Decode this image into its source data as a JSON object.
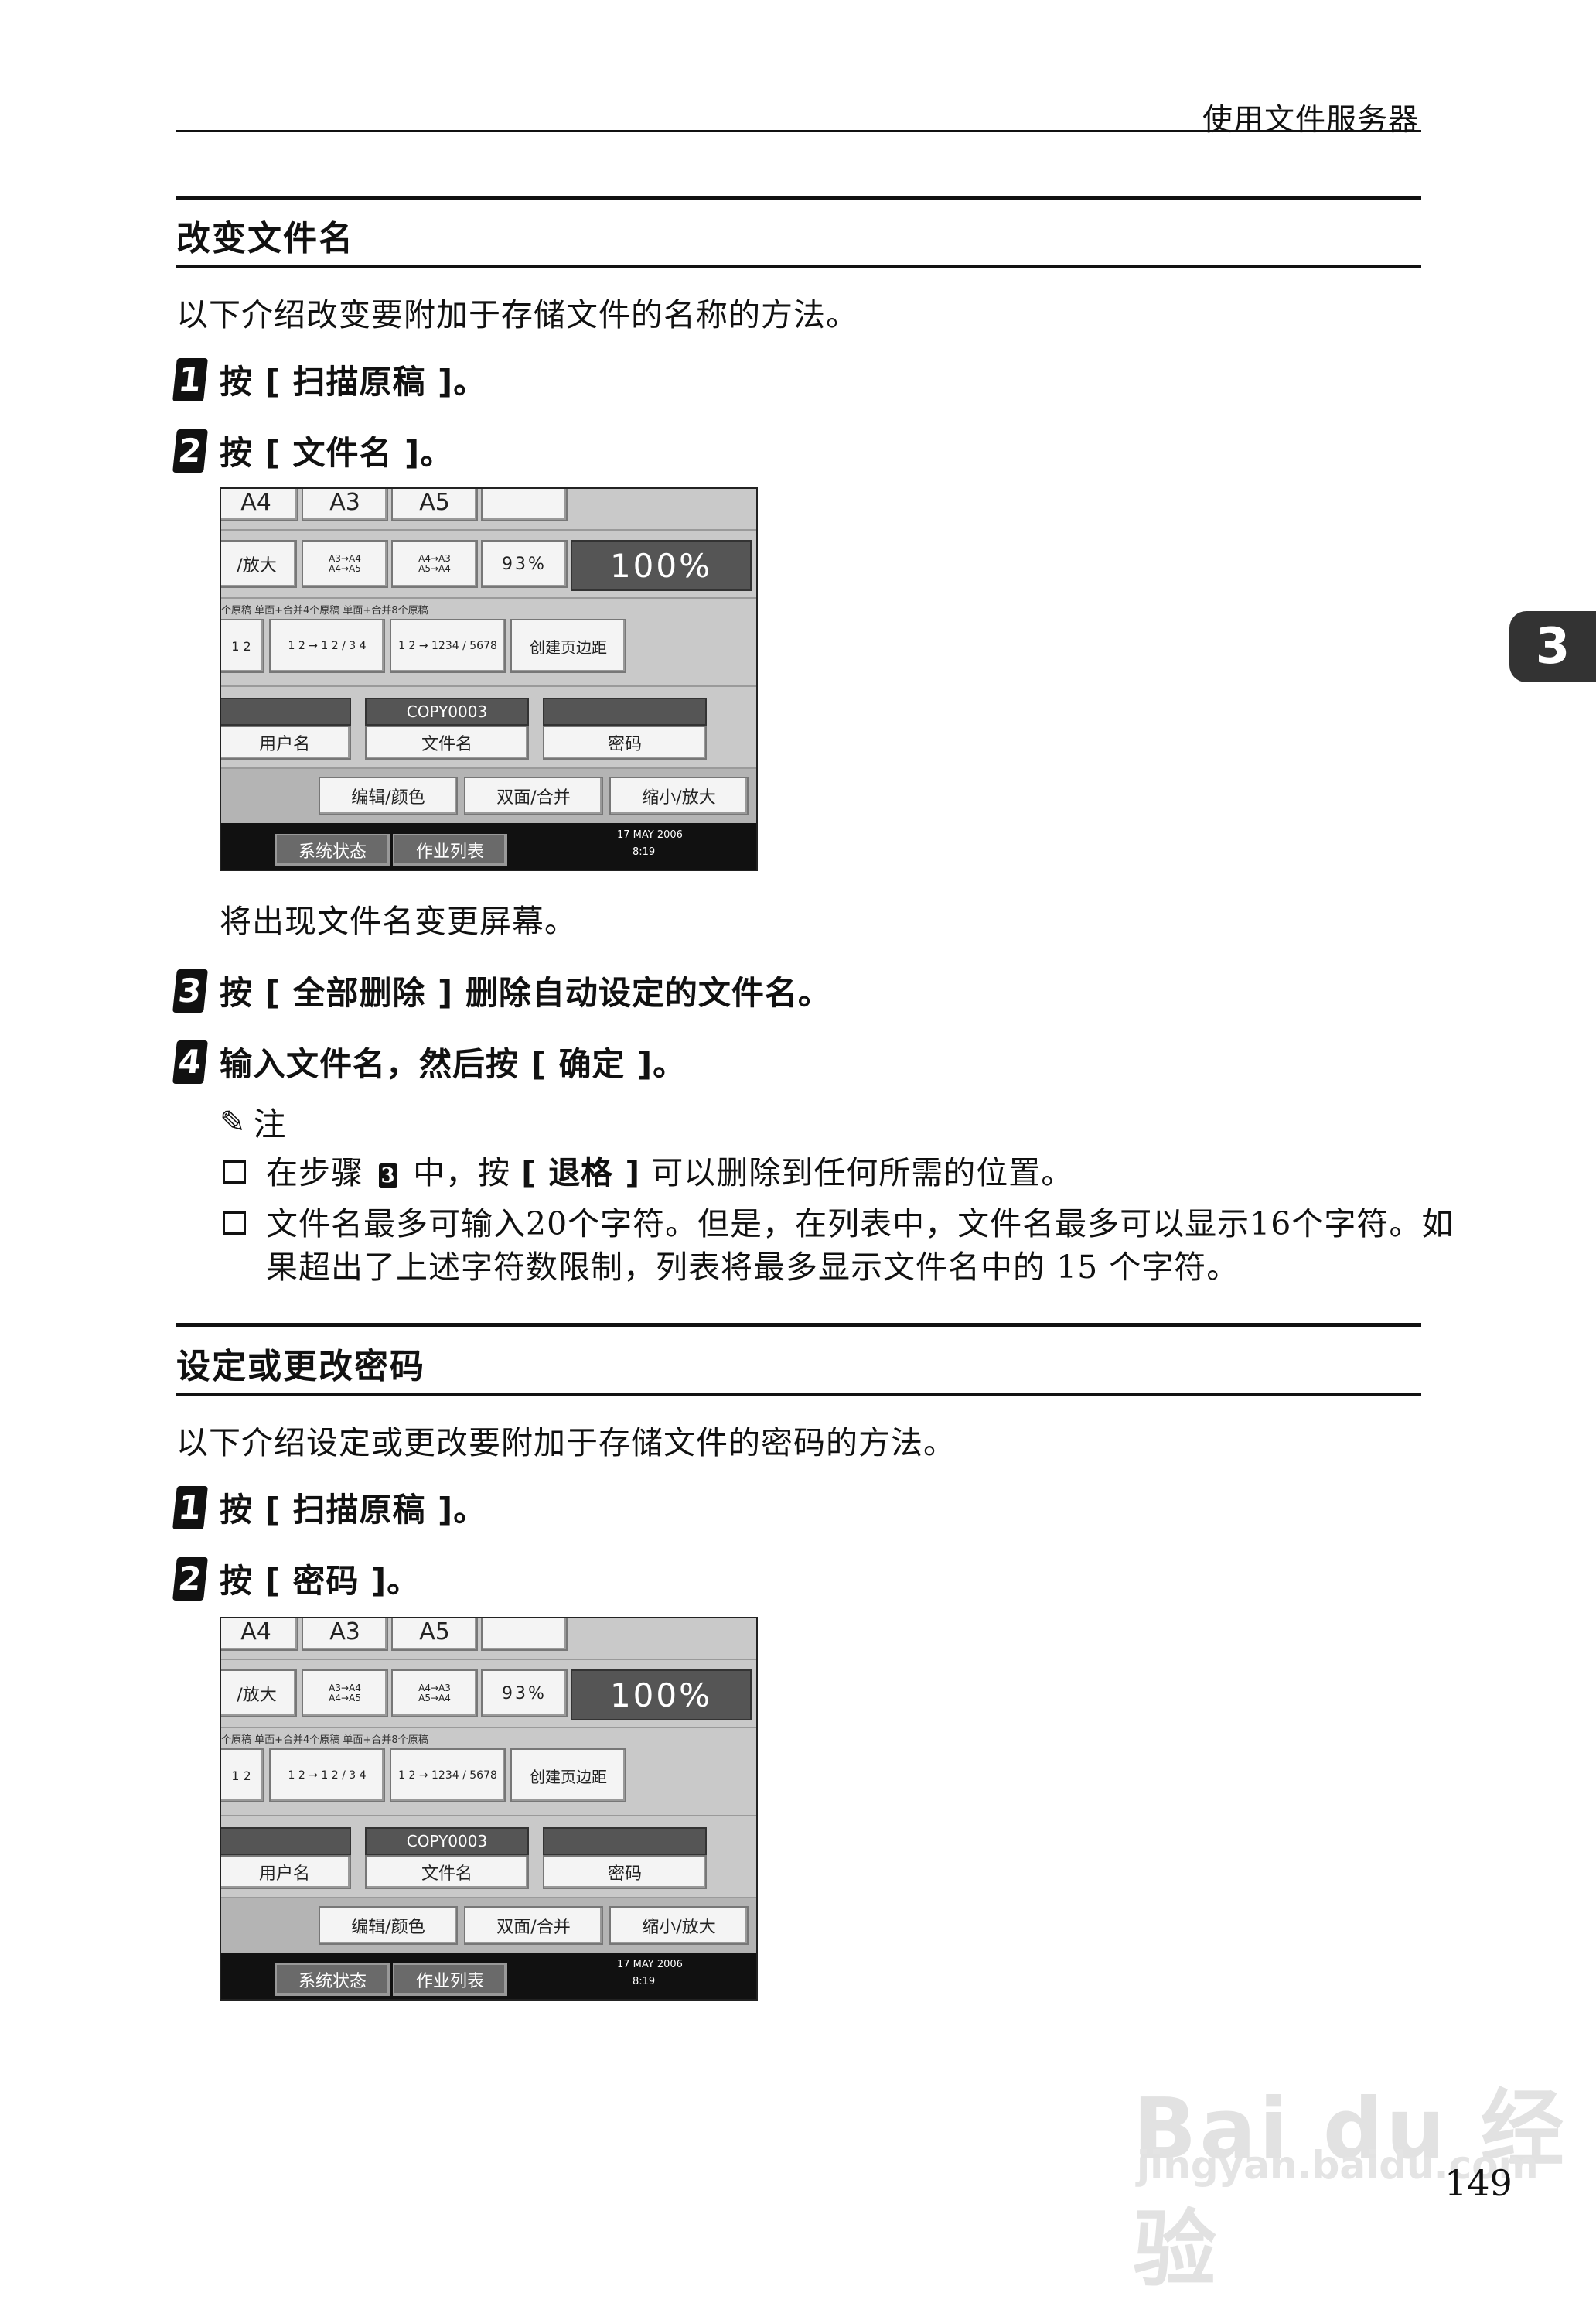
{
  "header": {
    "title": "使用文件服务器"
  },
  "side_tab": "3",
  "section1": {
    "title": "改变文件名",
    "intro": "以下介绍改变要附加于存储文件的名称的方法。",
    "steps": [
      {
        "num": "1",
        "text": "按 [ 扫描原稿 ]。"
      },
      {
        "num": "2",
        "text": "按 [ 文件名 ]。"
      },
      {
        "num": "3",
        "text": "按 [ 全部删除 ] 删除自动设定的文件名。"
      },
      {
        "num": "4",
        "text": "输入文件名，然后按 [ 确定 ]。"
      }
    ],
    "after_screen": "将出现文件名变更屏幕。",
    "note": {
      "label": "注",
      "item1_a": "在步骤",
      "item1_num": "3",
      "item1_b": "中，按",
      "item1_key": "[ 退格 ]",
      "item1_c": "可以删除到任何所需的位置。",
      "item2": "文件名最多可输入20个字符。但是，在列表中，文件名最多可以显示16个字符。如果超出了上述字符数限制，列表将最多显示文件名中的 15 个字符。"
    }
  },
  "section2": {
    "title": "设定或更改密码",
    "intro": "以下介绍设定或更改要附加于存储文件的密码的方法。",
    "steps": [
      {
        "num": "1",
        "text": "按 [ 扫描原稿 ]。"
      },
      {
        "num": "2",
        "text": "按 [ 密码 ]。"
      }
    ]
  },
  "screen": {
    "top_labels": [
      "A4",
      "A3",
      "A5"
    ],
    "enlarge": "/放大",
    "ratio1": "A3→A4\nA4→A5",
    "ratio2": "A4→A3\nA5→A4",
    "percent_small": "93%",
    "percent_big": "100%",
    "combine_label": "个原稿  单面+合并4个原稿  单面+合并8个原稿",
    "combine_a": "1 2",
    "combine_b": "1 2 → 1 2 / 3 4",
    "combine_c": "1 2 → 1234 / 5678",
    "margin": "创建页边距",
    "file_value": "COPY0003",
    "user": "用户名",
    "file": "文件名",
    "password": "密码",
    "edit_color": "编辑/颜色",
    "duplex": "双面/合并",
    "reduce": "缩小/放大",
    "status": "系统状态",
    "jobs": "作业列表",
    "date": "17 MAY  2006",
    "time": "8:19"
  },
  "watermark": {
    "brand": "Bai du 经验",
    "url": "jingyan.baidu.com"
  },
  "page_number": "149"
}
